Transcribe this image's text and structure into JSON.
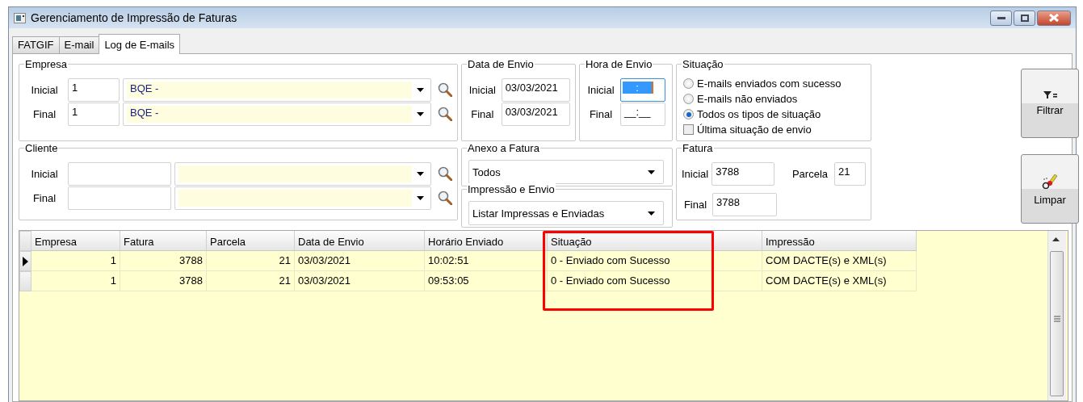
{
  "window": {
    "title": "Gerenciamento de Impressão de Faturas"
  },
  "tabs": [
    {
      "label": "FATGIF",
      "selected": false
    },
    {
      "label": "E-mail",
      "selected": false
    },
    {
      "label": "Log de E-mails",
      "selected": true
    }
  ],
  "empresa": {
    "title": "Empresa",
    "rows": [
      {
        "label": "Inicial",
        "code": "1",
        "name": "BQE -"
      },
      {
        "label": "Final",
        "code": "1",
        "name": "BQE -"
      }
    ]
  },
  "cliente": {
    "title": "Cliente",
    "rows": [
      {
        "label": "Inicial"
      },
      {
        "label": "Final"
      }
    ]
  },
  "data_envio": {
    "title": "Data de Envio",
    "fields": [
      {
        "label": "Inicial",
        "value": "03/03/2021"
      },
      {
        "label": "Final",
        "value": "03/03/2021"
      }
    ]
  },
  "hora_envio": {
    "title": "Hora de Envio",
    "fields": [
      {
        "label": "Inicial",
        "value": ":",
        "focused": true
      },
      {
        "label": "Final",
        "value": "__:__",
        "focused": false
      }
    ]
  },
  "situacao": {
    "title": "Situação",
    "options": [
      {
        "label": "E-mails enviados com sucesso",
        "selected": false
      },
      {
        "label": "E-mails não enviados",
        "selected": false
      },
      {
        "label": "Todos os tipos de situação",
        "selected": true
      }
    ],
    "checkbox": {
      "label": "Última situação de envio",
      "checked": false
    }
  },
  "anexo": {
    "title": "Anexo a Fatura",
    "value": "Todos"
  },
  "impressao_envio": {
    "title": "Impressão e Envio",
    "value": "Listar Impressas e Enviadas"
  },
  "fatura": {
    "title": "Fatura",
    "fields": [
      {
        "label": "Inicial",
        "value": "3788"
      },
      {
        "label": "Parcela",
        "value": "21"
      },
      {
        "label": "Final",
        "value": "3788"
      }
    ]
  },
  "buttons": [
    {
      "label": "Filtrar",
      "kind": "filter"
    },
    {
      "label": "Limpar",
      "kind": "clear"
    }
  ],
  "grid": {
    "columns": [
      {
        "label": "Empresa",
        "kind": "number",
        "highlighted": false
      },
      {
        "label": "Fatura",
        "kind": "number",
        "highlighted": false
      },
      {
        "label": "Parcela",
        "kind": "number",
        "highlighted": false
      },
      {
        "label": "Data de Envio",
        "kind": "text",
        "highlighted": false
      },
      {
        "label": "Horário Enviado",
        "kind": "text",
        "highlighted": false
      },
      {
        "label": "Situação",
        "kind": "text",
        "highlighted": true
      },
      {
        "label": "Impressão",
        "kind": "text",
        "highlighted": false
      }
    ],
    "rows": [
      {
        "selected": true,
        "cells": [
          "1",
          "3788",
          "21",
          "03/03/2021",
          "10:02:51",
          "0 - Enviado com Sucesso",
          "COM DACTE(s) e XML(s)"
        ]
      },
      {
        "selected": false,
        "cells": [
          "1",
          "3788",
          "21",
          "03/03/2021",
          "09:53:05",
          "0 - Enviado com Sucesso",
          "COM DACTE(s) e XML(s)"
        ]
      }
    ]
  }
}
